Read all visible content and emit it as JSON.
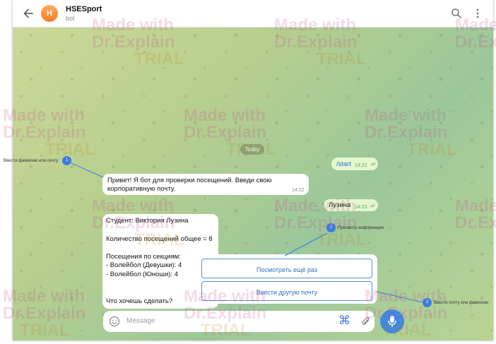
{
  "header": {
    "avatar_letter": "H",
    "title": "HSESport",
    "subtitle": "bot"
  },
  "chat": {
    "date_label": "Today",
    "messages": [
      {
        "text": "/start",
        "time": "14:22"
      },
      {
        "text": "Привет! Я бот для проверки посещений. Введи свою корпоративную почту.",
        "time": "14:22"
      },
      {
        "text": "Лузина",
        "time": "14:23"
      },
      {
        "line1": "Студент: Виктория Лузина",
        "line2": "Количество посещений общее = 8",
        "line3": "Посещения по секциям:",
        "line4": "- Волейбол (Девушки): 4",
        "line5": "- Волейбол (Юноши): 4",
        "line6": "Что хочешь сделать?"
      }
    ]
  },
  "keyboard": {
    "buttons": [
      "Посмотреть ещё раз",
      "Ввести другую почту"
    ]
  },
  "composer": {
    "placeholder": "Message"
  },
  "callouts": [
    {
      "number": "1",
      "label": "Ввести фамилию или почту"
    },
    {
      "number": "2",
      "label": "Просмотр информации"
    },
    {
      "number": "3",
      "label": "Ввести почту или фамилию"
    }
  ],
  "watermark": {
    "line1": "Made with",
    "line2": "Dr.Explain",
    "line3": "TRIAL"
  },
  "colors": {
    "accent": "#3f8ae0",
    "outgoing_bubble": "#e3f8cf",
    "incoming_bubble": "#ffffff",
    "avatar": "#f47d2a"
  },
  "icons": [
    "back-arrow-icon",
    "search-icon",
    "more-vert-icon",
    "double-check-icon",
    "emoji-icon",
    "bot-command-icon",
    "paperclip-icon",
    "microphone-icon"
  ]
}
